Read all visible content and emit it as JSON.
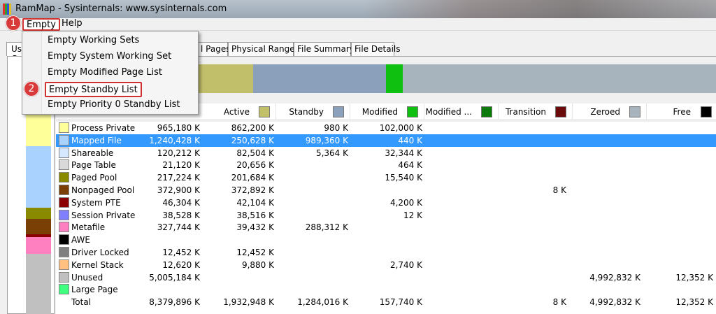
{
  "window": {
    "title": "RamMap - Sysinternals: www.sysinternals.com"
  },
  "menubar": {
    "items": [
      "Empty",
      "Help"
    ]
  },
  "annotations": {
    "badge1": "1",
    "badge2": "2"
  },
  "dropdown": {
    "items": [
      "Empty Working Sets",
      "Empty System Working Set",
      "Empty Modified Page List",
      "Empty Standby List",
      "Empty Priority 0 Standby List"
    ],
    "highlighted_index": 3
  },
  "left_tab": {
    "label": "Use Counts"
  },
  "tabs": [
    "l Pages",
    "Physical Ranges",
    "File Summary",
    "File Details"
  ],
  "columns": {
    "active": "Active",
    "standby": "Standby",
    "modified": "Modified",
    "modified_nw": "Modified ...",
    "transition": "Transition",
    "zeroed": "Zeroed",
    "free": "Free"
  },
  "colors": {
    "active": "#c2bf6a",
    "standby": "#8aa0bb",
    "modified": "#10c010",
    "modified_nw": "#0d7a0d",
    "transition": "#6a0a0a",
    "zeroed": "#a8b4bd",
    "free": "#000000",
    "selection": "#3399ff",
    "annotation": "#d03030"
  },
  "rows": [
    {
      "label": "Process Private",
      "color": "#ffff99",
      "total": "965,180 K",
      "active": "862,200 K",
      "standby": "980 K",
      "modified": "102,000 K",
      "transition": "",
      "zeroed": "",
      "free": ""
    },
    {
      "label": "Mapped File",
      "color": "#aad2ff",
      "total": "1,240,428 K",
      "active": "250,628 K",
      "standby": "989,360 K",
      "modified": "440 K",
      "transition": "",
      "zeroed": "",
      "free": ""
    },
    {
      "label": "Shareable",
      "color": "#d6e8ff",
      "total": "120,212 K",
      "active": "82,504 K",
      "standby": "5,364 K",
      "modified": "32,344 K",
      "transition": "",
      "zeroed": "",
      "free": ""
    },
    {
      "label": "Page Table",
      "color": "#d9d9d9",
      "total": "21,120 K",
      "active": "20,656 K",
      "standby": "",
      "modified": "464 K",
      "transition": "",
      "zeroed": "",
      "free": ""
    },
    {
      "label": "Paged Pool",
      "color": "#8a8a00",
      "total": "217,224 K",
      "active": "201,684 K",
      "standby": "",
      "modified": "15,540 K",
      "transition": "",
      "zeroed": "",
      "free": ""
    },
    {
      "label": "Nonpaged Pool",
      "color": "#7a3f05",
      "total": "372,900 K",
      "active": "372,892 K",
      "standby": "",
      "modified": "",
      "transition": "8 K",
      "zeroed": "",
      "free": ""
    },
    {
      "label": "System PTE",
      "color": "#8b0000",
      "total": "46,304 K",
      "active": "42,104 K",
      "standby": "",
      "modified": "4,200 K",
      "transition": "",
      "zeroed": "",
      "free": ""
    },
    {
      "label": "Session Private",
      "color": "#8080ff",
      "total": "38,528 K",
      "active": "38,516 K",
      "standby": "",
      "modified": "12 K",
      "transition": "",
      "zeroed": "",
      "free": ""
    },
    {
      "label": "Metafile",
      "color": "#ff80c0",
      "total": "327,744 K",
      "active": "39,432 K",
      "standby": "288,312 K",
      "modified": "",
      "transition": "",
      "zeroed": "",
      "free": ""
    },
    {
      "label": "AWE",
      "color": "#000000",
      "total": "",
      "active": "",
      "standby": "",
      "modified": "",
      "transition": "",
      "zeroed": "",
      "free": ""
    },
    {
      "label": "Driver Locked",
      "color": "#808080",
      "total": "12,452 K",
      "active": "12,452 K",
      "standby": "",
      "modified": "",
      "transition": "",
      "zeroed": "",
      "free": ""
    },
    {
      "label": "Kernel Stack",
      "color": "#ffc080",
      "total": "12,620 K",
      "active": "9,880 K",
      "standby": "",
      "modified": "2,740 K",
      "transition": "",
      "zeroed": "",
      "free": ""
    },
    {
      "label": "Unused",
      "color": "#c0c0c0",
      "total": "5,005,184 K",
      "active": "",
      "standby": "",
      "modified": "",
      "transition": "",
      "zeroed": "4,992,832 K",
      "free": "12,352 K"
    },
    {
      "label": "Large Page",
      "color": "#40ff80",
      "total": "",
      "active": "",
      "standby": "",
      "modified": "",
      "transition": "",
      "zeroed": "",
      "free": ""
    },
    {
      "label": "Total",
      "color": "",
      "total": "8,379,896 K",
      "active": "1,932,948 K",
      "standby": "1,284,016 K",
      "modified": "157,740 K",
      "transition": "8 K",
      "zeroed": "4,992,832 K",
      "free": "12,352 K"
    }
  ]
}
